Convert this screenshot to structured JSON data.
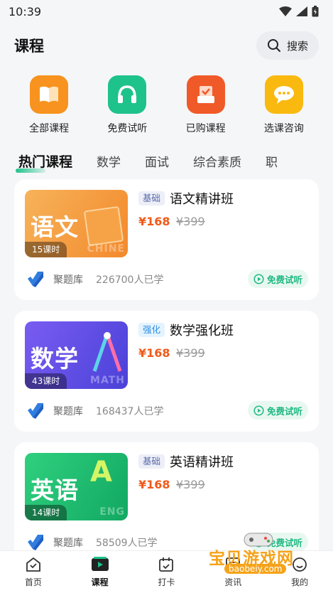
{
  "status_bar": {
    "time": "10:39"
  },
  "header": {
    "title": "课程",
    "search_label": "搜索"
  },
  "quick_actions": [
    {
      "label": "全部课程",
      "icon": "book-icon",
      "color": "#f7931e"
    },
    {
      "label": "免费试听",
      "icon": "headphones-icon",
      "color": "#1ec28b"
    },
    {
      "label": "已购课程",
      "icon": "purchased-box-icon",
      "color": "#f05a28"
    },
    {
      "label": "选课咨询",
      "icon": "chat-bubble-icon",
      "color": "#f9b90f"
    }
  ],
  "tabs": [
    {
      "label": "热门课程",
      "active": true
    },
    {
      "label": "数学"
    },
    {
      "label": "面试"
    },
    {
      "label": "综合素质"
    },
    {
      "label": "职"
    }
  ],
  "courses": [
    {
      "thumb_title": "语文",
      "thumb_en": "CHINE",
      "hours": "15课时",
      "badge": "基础",
      "title": "语文精讲班",
      "price": "¥168",
      "original_price": "¥399",
      "provider": "聚题库",
      "learners": "226700人已学",
      "action": "免费试听",
      "thumb_color": "#f79a3a"
    },
    {
      "thumb_title": "数学",
      "thumb_en": "MATH",
      "hours": "43课时",
      "badge": "强化",
      "title": "数学强化班",
      "price": "¥168",
      "original_price": "¥399",
      "provider": "聚题库",
      "learners": "168437人已学",
      "action": "免费试听",
      "thumb_color": "#5a4fe0"
    },
    {
      "thumb_title": "英语",
      "thumb_en": "ENG",
      "hours": "14课时",
      "badge": "基础",
      "title": "英语精讲班",
      "price": "¥168",
      "original_price": "¥399",
      "provider": "聚题库",
      "learners": "58509人已学",
      "action": "免费试听",
      "thumb_color": "#1ec27a"
    }
  ],
  "bottom_nav": [
    {
      "label": "首页",
      "icon": "home-icon"
    },
    {
      "label": "课程",
      "icon": "play-course-icon",
      "active": true
    },
    {
      "label": "打卡",
      "icon": "calendar-check-icon"
    },
    {
      "label": "资讯",
      "icon": "news-icon"
    },
    {
      "label": "我的",
      "icon": "profile-icon"
    }
  ],
  "watermark": {
    "text": "宝贝游戏网",
    "url": "baobeiy.com"
  }
}
